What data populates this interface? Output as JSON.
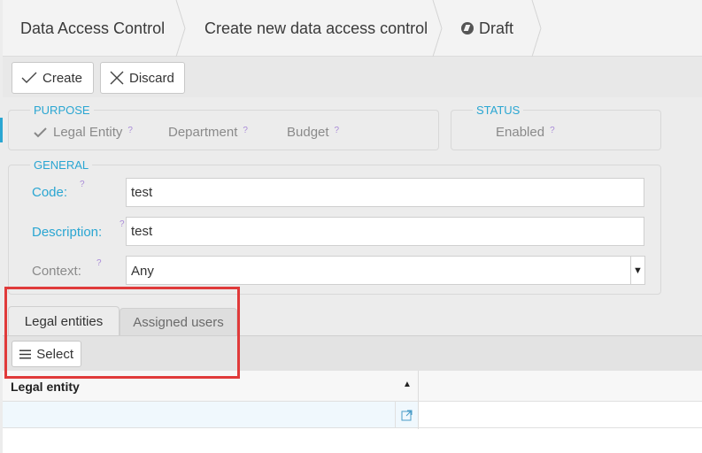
{
  "breadcrumb": {
    "items": [
      "Data Access Control",
      "Create new data access control"
    ],
    "status": "Draft"
  },
  "toolbar": {
    "create_label": "Create",
    "discard_label": "Discard"
  },
  "purpose": {
    "legend": "PURPOSE",
    "options": [
      {
        "label": "Legal Entity",
        "checked": true
      },
      {
        "label": "Department",
        "checked": false
      },
      {
        "label": "Budget",
        "checked": false
      }
    ]
  },
  "status": {
    "legend": "STATUS",
    "enabled_label": "Enabled"
  },
  "general": {
    "legend": "GENERAL",
    "code_label": "Code:",
    "code_value": "test",
    "description_label": "Description:",
    "description_value": "test",
    "context_label": "Context:",
    "context_value": "Any"
  },
  "help_mark": "?",
  "tabs": {
    "active": "Legal entities",
    "inactive": "Assigned users"
  },
  "tab_toolbar": {
    "select_label": "Select"
  },
  "grid": {
    "column_header": "Legal entity",
    "sort_indicator": "▲"
  },
  "colors": {
    "accent": "#2aa6d2",
    "highlight": "#e03a3a",
    "help": "#a98bd8"
  }
}
